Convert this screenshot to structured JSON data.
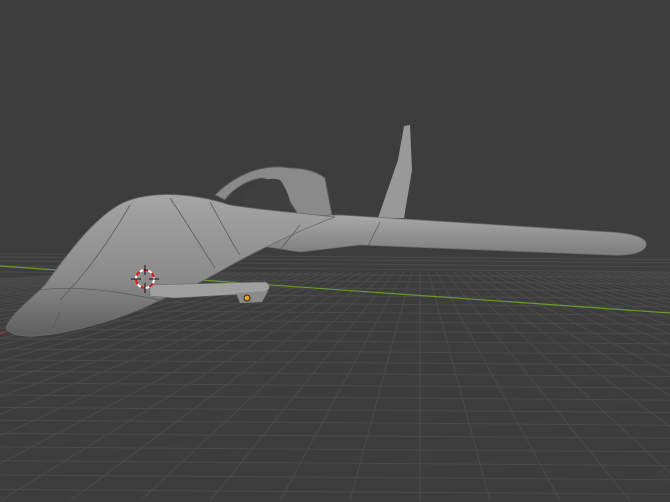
{
  "viewport": {
    "background": "#3d3d3d",
    "grid_color": "#4a4a4a",
    "x_axis_color": "#6a9a2a",
    "y_axis_color": "#9a3a3a",
    "model_color": "#8e8e8e"
  },
  "icons": [
    "3d-cursor-icon",
    "object-origin-icon"
  ]
}
